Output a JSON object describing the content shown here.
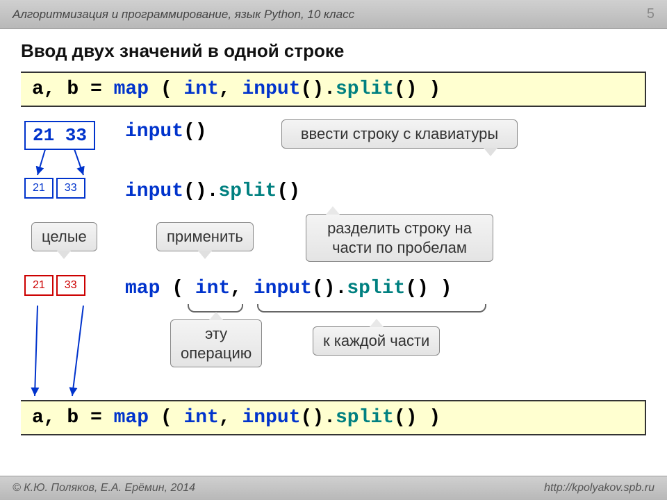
{
  "header": {
    "breadcrumb": "Алгоритмизация и программирование, язык Python, 10 класс",
    "page": "5"
  },
  "title": "Ввод двух значений в одной строке",
  "code_top": {
    "t1": "a, b = ",
    "t2": "map",
    "t3": " ( ",
    "t4": "int",
    "t5": ", ",
    "t6": "input",
    "t7": "().",
    "t8": "split",
    "t9": "() )"
  },
  "step1": {
    "box": "21 33",
    "code_fn": "input",
    "code_rest": "()"
  },
  "callout_input": "ввести строку с клавиатуры",
  "step2": {
    "left": "21",
    "right": "33",
    "c1": "input",
    "c2": "().",
    "c3": "split",
    "c4": "()"
  },
  "callout_integers": "целые",
  "callout_apply": "применить",
  "callout_split": "разделить строку на\nчасти по пробелам",
  "step3": {
    "left": "21",
    "right": "33",
    "c1": "map",
    "c2": " ( ",
    "c3": "int",
    "c4": ", ",
    "c5": "input",
    "c6": "().",
    "c7": "split",
    "c8": "() )"
  },
  "callout_operation": "эту\nоперацию",
  "callout_eachpart": "к каждой части",
  "code_bottom": {
    "t1": "a, b = ",
    "t2": "map",
    "t3": " ( ",
    "t4": "int",
    "t5": ", ",
    "t6": "input",
    "t7": "().",
    "t8": "split",
    "t9": "() )"
  },
  "footer": {
    "left": "© К.Ю. Поляков, Е.А. Ерёмин, 2014",
    "right": "http://kpolyakov.spb.ru"
  }
}
